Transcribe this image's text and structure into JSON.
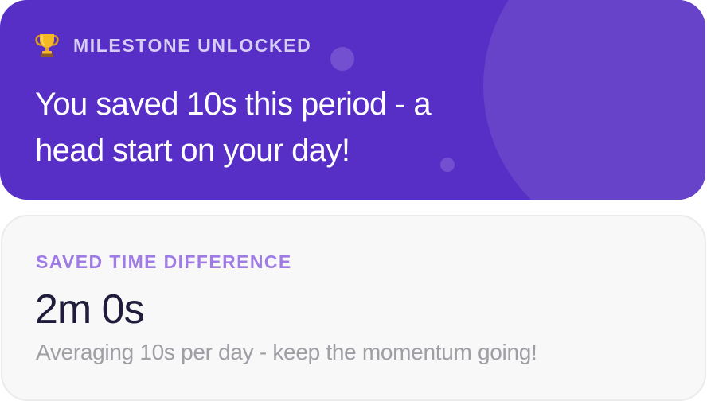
{
  "milestone": {
    "icon": "trophy-icon",
    "label": "MILESTONE UNLOCKED",
    "title": "You saved 10s this period - a head start on your day!",
    "background_color": "#582fc6",
    "accent_circle_color": "#6643c8"
  },
  "saved_time": {
    "label": "SAVED TIME DIFFERENCE",
    "value": "2m 0s",
    "subtitle": "Averaging 10s per day - keep the momentum going!",
    "label_color": "#9f7be6",
    "value_color": "#1f1d3b",
    "subtitle_color": "#9e9ea5"
  }
}
